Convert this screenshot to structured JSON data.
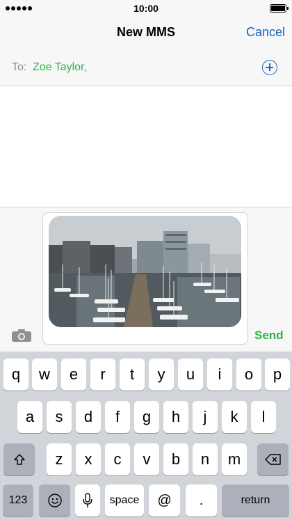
{
  "status_bar": {
    "time": "10:00"
  },
  "nav": {
    "title": "New MMS",
    "cancel_label": "Cancel"
  },
  "recipients": {
    "label": "To:",
    "value": "Zoe Taylor,"
  },
  "compose": {
    "send_label": "Send",
    "attachment_icon": "marina-photo"
  },
  "keyboard": {
    "row1": [
      "q",
      "w",
      "e",
      "r",
      "t",
      "y",
      "u",
      "i",
      "o",
      "p"
    ],
    "row2": [
      "a",
      "s",
      "d",
      "f",
      "g",
      "h",
      "j",
      "k",
      "l"
    ],
    "row3": [
      "z",
      "x",
      "c",
      "v",
      "b",
      "n",
      "m"
    ],
    "numbers_label": "123",
    "space_label": "space",
    "at_label": "@",
    "period_label": ".",
    "return_label": "return"
  },
  "colors": {
    "accent_blue": "#1565c0",
    "send_green": "#2db34a",
    "keyboard_bg": "#d1d4d9"
  }
}
